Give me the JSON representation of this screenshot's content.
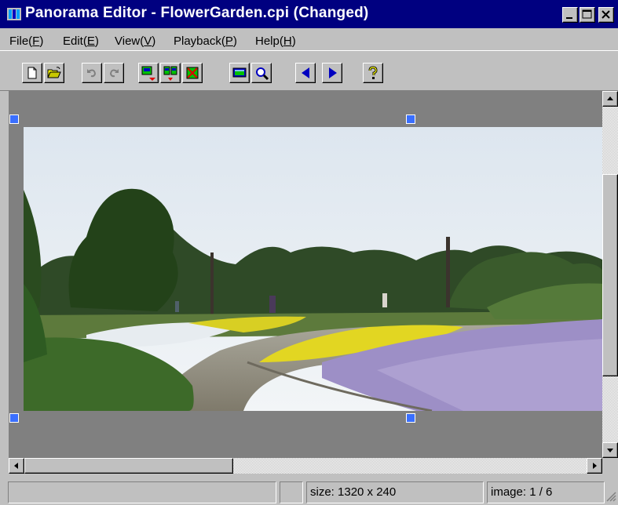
{
  "window": {
    "title": "Panorama Editor - FlowerGarden.cpi (Changed)",
    "title_bar_color": "#000080"
  },
  "menu": {
    "items": [
      {
        "label": "File(F)",
        "text": "File(",
        "accel": "F",
        "suffix": ")"
      },
      {
        "label": "Edit(E)",
        "text": "Edit(",
        "accel": "E",
        "suffix": ")"
      },
      {
        "label": "View(V)",
        "text": "View(",
        "accel": "V",
        "suffix": ")"
      },
      {
        "label": "Playback(P)",
        "text": "Playback(",
        "accel": "P",
        "suffix": ")"
      },
      {
        "label": "Help(H)",
        "text": "Help(",
        "accel": "H",
        "suffix": ")"
      }
    ]
  },
  "toolbar": {
    "buttons": [
      {
        "name": "new-document",
        "icon": "new-file-icon",
        "enabled": true
      },
      {
        "name": "open-file",
        "icon": "open-folder-icon",
        "enabled": true
      },
      {
        "name": "undo",
        "icon": "undo-icon",
        "enabled": false
      },
      {
        "name": "redo",
        "icon": "redo-icon",
        "enabled": false
      },
      {
        "name": "insert-image",
        "icon": "insert-image-icon",
        "enabled": true
      },
      {
        "name": "insert-split",
        "icon": "insert-split-icon",
        "enabled": true
      },
      {
        "name": "delete-image",
        "icon": "delete-image-icon",
        "enabled": true
      },
      {
        "name": "preview",
        "icon": "preview-icon",
        "enabled": true
      },
      {
        "name": "zoom",
        "icon": "magnifier-icon",
        "enabled": true
      },
      {
        "name": "previous",
        "icon": "left-arrow-icon",
        "enabled": true
      },
      {
        "name": "next",
        "icon": "right-arrow-icon",
        "enabled": true
      },
      {
        "name": "help",
        "icon": "question-mark-icon",
        "enabled": true
      }
    ]
  },
  "canvas": {
    "background": "#808080",
    "handle_color": "#3a6fff",
    "image_description_icon": "panorama-flower-garden-image"
  },
  "status": {
    "panel1": "",
    "panel2": "",
    "size": "size: 1320 x 240",
    "image": "image: 1 / 6"
  },
  "colors": {
    "face": "#c0c0c0",
    "shadow": "#808080",
    "highlight": "#ffffff",
    "accent_blue": "#0000c0",
    "accent_red": "#e00000",
    "yellow": "#ffff00"
  }
}
